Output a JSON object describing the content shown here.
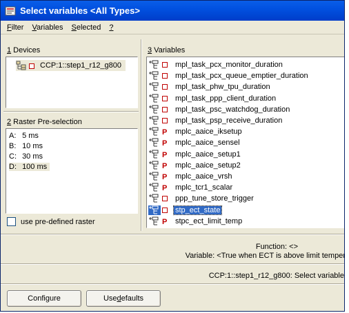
{
  "window": {
    "title": "Select variables <All Types>"
  },
  "menu": [
    {
      "label": "Filter",
      "mnemonic": "F",
      "rest": "ilter"
    },
    {
      "label": "Variables",
      "mnemonic": "V",
      "rest": "ariables"
    },
    {
      "label": "Selected",
      "mnemonic": "S",
      "rest": "elected"
    },
    {
      "label": "?",
      "mnemonic": "?",
      "rest": ""
    }
  ],
  "devices": {
    "heading_num": "1",
    "heading_text": " Devices",
    "items": [
      {
        "label": "CCP:1::step1_r12_g800"
      }
    ]
  },
  "raster": {
    "heading_num": "2",
    "heading_text": " Raster Pre-selection",
    "items": [
      {
        "key": "A:",
        "value": "5 ms"
      },
      {
        "key": "B:",
        "value": "10 ms"
      },
      {
        "key": "C:",
        "value": "30 ms"
      },
      {
        "key": "D:",
        "value": "100 ms"
      }
    ],
    "checkbox_label": "use pre-defined raster"
  },
  "variables": {
    "heading_num": "3",
    "heading_text": " Variables",
    "items": [
      {
        "name": "mpl_task_pcx_monitor_duration",
        "flag": "box"
      },
      {
        "name": "mpl_task_pcx_queue_emptier_duration",
        "flag": "box"
      },
      {
        "name": "mpl_task_phw_tpu_duration",
        "flag": "box"
      },
      {
        "name": "mpl_task_ppp_client_duration",
        "flag": "box"
      },
      {
        "name": "mpl_task_psc_watchdog_duration",
        "flag": "box"
      },
      {
        "name": "mpl_task_psp_receive_duration",
        "flag": "box"
      },
      {
        "name": "mplc_aaice_iksetup",
        "flag": "P"
      },
      {
        "name": "mplc_aaice_sensel",
        "flag": "P"
      },
      {
        "name": "mplc_aaice_setup1",
        "flag": "P"
      },
      {
        "name": "mplc_aaice_setup2",
        "flag": "P"
      },
      {
        "name": "mplc_aaice_vrsh",
        "flag": "P"
      },
      {
        "name": "mplc_tcr1_scalar",
        "flag": "P"
      },
      {
        "name": "ppp_tune_store_trigger",
        "flag": "box"
      },
      {
        "name": "stp_ect_state",
        "flag": "box",
        "selected": true
      },
      {
        "name": "stpc_ect_limit_temp",
        "flag": "P"
      }
    ]
  },
  "info": {
    "function_text": "Function: <>",
    "variable_text": "Variable: <True when ECT is above limit temper",
    "status_text": "CCP:1::step1_r12_g800: Select variable"
  },
  "buttons": {
    "configure_label_pre": "Confi",
    "configure_mnemonic": "g",
    "configure_label_post": "ure",
    "defaults_label_pre": "Use ",
    "defaults_mnemonic": "d",
    "defaults_label_post": "efaults"
  }
}
